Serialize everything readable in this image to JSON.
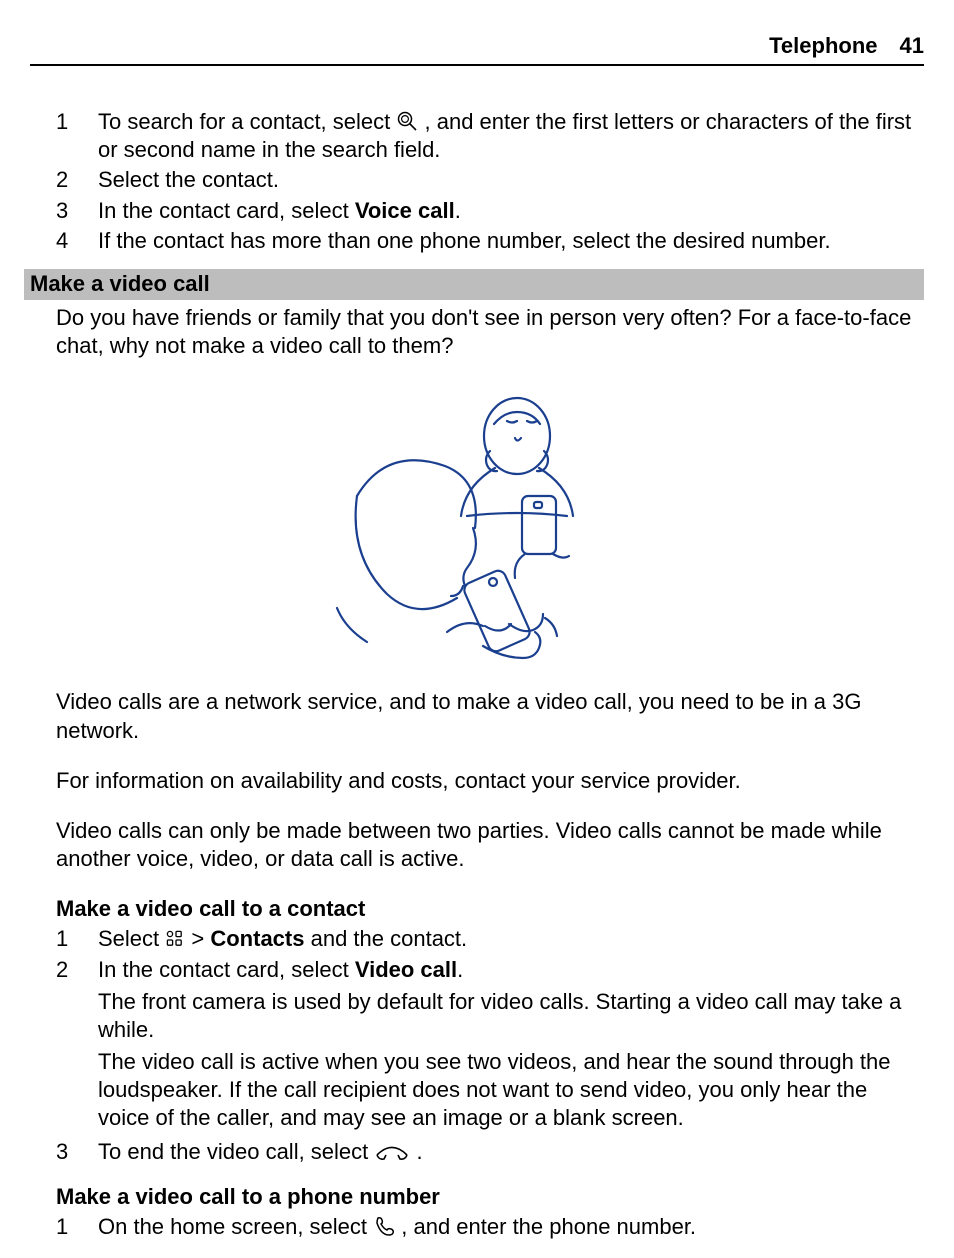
{
  "header": {
    "section": "Telephone",
    "page": "41"
  },
  "steps_top": [
    {
      "n": "1",
      "pre": "To search for a contact, select ",
      "post": ", and enter the first letters or characters of the first or second name in the search field."
    },
    {
      "n": "2",
      "text": "Select the contact."
    },
    {
      "n": "3",
      "pre": "In the contact card, select ",
      "bold": "Voice call",
      "post": "."
    },
    {
      "n": "4",
      "text": "If the contact has more than one phone number, select the desired number."
    }
  ],
  "section_bar": "Make a video call",
  "intro": "Do you have friends or family that you don't see in person very often? For a face-to-face chat, why not make a video call to them?",
  "para1": "Video calls are a network service, and to make a video call, you need to be in a 3G network.",
  "para2": "For information on availability and costs, contact your service provider.",
  "para3": "Video calls can only be made between two parties. Video calls cannot be made while another voice, video, or data call is active.",
  "sub1": "Make a video call to a contact",
  "s1": {
    "n1": "1",
    "n1_pre": "Select ",
    "n1_mid": " > ",
    "n1_bold": "Contacts",
    "n1_post": " and the contact.",
    "n2": "2",
    "n2_pre": "In the contact card, select ",
    "n2_bold": "Video call",
    "n2_post": ".",
    "n2_p2": "The front camera is used by default for video calls. Starting a video call may take a while.",
    "n2_p3": "The video call is active when you see two videos, and hear the sound through the loudspeaker. If the call recipient does not want to send video, you only hear the voice of the caller, and may see an image or a blank screen.",
    "n3": "3",
    "n3_pre": "To end the video call, select ",
    "n3_post": "."
  },
  "sub2": "Make a video call to a phone number",
  "s2": {
    "n1": "1",
    "n1_pre": "On the home screen, select ",
    "n1_post": ", and enter the phone number."
  }
}
